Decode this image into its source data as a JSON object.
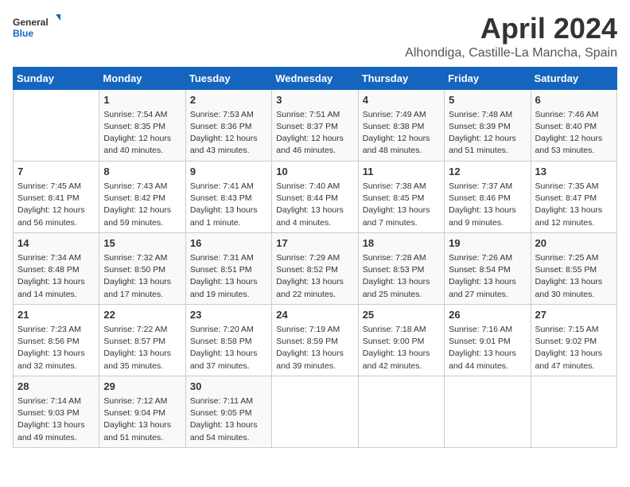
{
  "header": {
    "logo_general": "General",
    "logo_blue": "Blue",
    "title": "April 2024",
    "subtitle": "Alhondiga, Castille-La Mancha, Spain"
  },
  "days_of_week": [
    "Sunday",
    "Monday",
    "Tuesday",
    "Wednesday",
    "Thursday",
    "Friday",
    "Saturday"
  ],
  "weeks": [
    [
      {
        "day": "",
        "sunrise": "",
        "sunset": "",
        "daylight": ""
      },
      {
        "day": "1",
        "sunrise": "Sunrise: 7:54 AM",
        "sunset": "Sunset: 8:35 PM",
        "daylight": "Daylight: 12 hours and 40 minutes."
      },
      {
        "day": "2",
        "sunrise": "Sunrise: 7:53 AM",
        "sunset": "Sunset: 8:36 PM",
        "daylight": "Daylight: 12 hours and 43 minutes."
      },
      {
        "day": "3",
        "sunrise": "Sunrise: 7:51 AM",
        "sunset": "Sunset: 8:37 PM",
        "daylight": "Daylight: 12 hours and 46 minutes."
      },
      {
        "day": "4",
        "sunrise": "Sunrise: 7:49 AM",
        "sunset": "Sunset: 8:38 PM",
        "daylight": "Daylight: 12 hours and 48 minutes."
      },
      {
        "day": "5",
        "sunrise": "Sunrise: 7:48 AM",
        "sunset": "Sunset: 8:39 PM",
        "daylight": "Daylight: 12 hours and 51 minutes."
      },
      {
        "day": "6",
        "sunrise": "Sunrise: 7:46 AM",
        "sunset": "Sunset: 8:40 PM",
        "daylight": "Daylight: 12 hours and 53 minutes."
      }
    ],
    [
      {
        "day": "7",
        "sunrise": "Sunrise: 7:45 AM",
        "sunset": "Sunset: 8:41 PM",
        "daylight": "Daylight: 12 hours and 56 minutes."
      },
      {
        "day": "8",
        "sunrise": "Sunrise: 7:43 AM",
        "sunset": "Sunset: 8:42 PM",
        "daylight": "Daylight: 12 hours and 59 minutes."
      },
      {
        "day": "9",
        "sunrise": "Sunrise: 7:41 AM",
        "sunset": "Sunset: 8:43 PM",
        "daylight": "Daylight: 13 hours and 1 minute."
      },
      {
        "day": "10",
        "sunrise": "Sunrise: 7:40 AM",
        "sunset": "Sunset: 8:44 PM",
        "daylight": "Daylight: 13 hours and 4 minutes."
      },
      {
        "day": "11",
        "sunrise": "Sunrise: 7:38 AM",
        "sunset": "Sunset: 8:45 PM",
        "daylight": "Daylight: 13 hours and 7 minutes."
      },
      {
        "day": "12",
        "sunrise": "Sunrise: 7:37 AM",
        "sunset": "Sunset: 8:46 PM",
        "daylight": "Daylight: 13 hours and 9 minutes."
      },
      {
        "day": "13",
        "sunrise": "Sunrise: 7:35 AM",
        "sunset": "Sunset: 8:47 PM",
        "daylight": "Daylight: 13 hours and 12 minutes."
      }
    ],
    [
      {
        "day": "14",
        "sunrise": "Sunrise: 7:34 AM",
        "sunset": "Sunset: 8:48 PM",
        "daylight": "Daylight: 13 hours and 14 minutes."
      },
      {
        "day": "15",
        "sunrise": "Sunrise: 7:32 AM",
        "sunset": "Sunset: 8:50 PM",
        "daylight": "Daylight: 13 hours and 17 minutes."
      },
      {
        "day": "16",
        "sunrise": "Sunrise: 7:31 AM",
        "sunset": "Sunset: 8:51 PM",
        "daylight": "Daylight: 13 hours and 19 minutes."
      },
      {
        "day": "17",
        "sunrise": "Sunrise: 7:29 AM",
        "sunset": "Sunset: 8:52 PM",
        "daylight": "Daylight: 13 hours and 22 minutes."
      },
      {
        "day": "18",
        "sunrise": "Sunrise: 7:28 AM",
        "sunset": "Sunset: 8:53 PM",
        "daylight": "Daylight: 13 hours and 25 minutes."
      },
      {
        "day": "19",
        "sunrise": "Sunrise: 7:26 AM",
        "sunset": "Sunset: 8:54 PM",
        "daylight": "Daylight: 13 hours and 27 minutes."
      },
      {
        "day": "20",
        "sunrise": "Sunrise: 7:25 AM",
        "sunset": "Sunset: 8:55 PM",
        "daylight": "Daylight: 13 hours and 30 minutes."
      }
    ],
    [
      {
        "day": "21",
        "sunrise": "Sunrise: 7:23 AM",
        "sunset": "Sunset: 8:56 PM",
        "daylight": "Daylight: 13 hours and 32 minutes."
      },
      {
        "day": "22",
        "sunrise": "Sunrise: 7:22 AM",
        "sunset": "Sunset: 8:57 PM",
        "daylight": "Daylight: 13 hours and 35 minutes."
      },
      {
        "day": "23",
        "sunrise": "Sunrise: 7:20 AM",
        "sunset": "Sunset: 8:58 PM",
        "daylight": "Daylight: 13 hours and 37 minutes."
      },
      {
        "day": "24",
        "sunrise": "Sunrise: 7:19 AM",
        "sunset": "Sunset: 8:59 PM",
        "daylight": "Daylight: 13 hours and 39 minutes."
      },
      {
        "day": "25",
        "sunrise": "Sunrise: 7:18 AM",
        "sunset": "Sunset: 9:00 PM",
        "daylight": "Daylight: 13 hours and 42 minutes."
      },
      {
        "day": "26",
        "sunrise": "Sunrise: 7:16 AM",
        "sunset": "Sunset: 9:01 PM",
        "daylight": "Daylight: 13 hours and 44 minutes."
      },
      {
        "day": "27",
        "sunrise": "Sunrise: 7:15 AM",
        "sunset": "Sunset: 9:02 PM",
        "daylight": "Daylight: 13 hours and 47 minutes."
      }
    ],
    [
      {
        "day": "28",
        "sunrise": "Sunrise: 7:14 AM",
        "sunset": "Sunset: 9:03 PM",
        "daylight": "Daylight: 13 hours and 49 minutes."
      },
      {
        "day": "29",
        "sunrise": "Sunrise: 7:12 AM",
        "sunset": "Sunset: 9:04 PM",
        "daylight": "Daylight: 13 hours and 51 minutes."
      },
      {
        "day": "30",
        "sunrise": "Sunrise: 7:11 AM",
        "sunset": "Sunset: 9:05 PM",
        "daylight": "Daylight: 13 hours and 54 minutes."
      },
      {
        "day": "",
        "sunrise": "",
        "sunset": "",
        "daylight": ""
      },
      {
        "day": "",
        "sunrise": "",
        "sunset": "",
        "daylight": ""
      },
      {
        "day": "",
        "sunrise": "",
        "sunset": "",
        "daylight": ""
      },
      {
        "day": "",
        "sunrise": "",
        "sunset": "",
        "daylight": ""
      }
    ]
  ]
}
